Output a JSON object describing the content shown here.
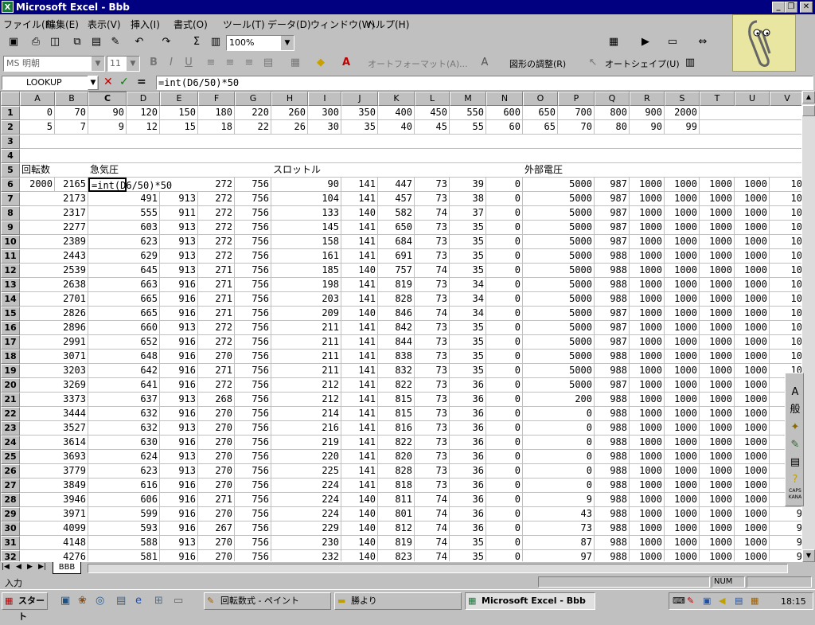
{
  "window": {
    "title": "Microsoft Excel - Bbb",
    "app_icon": "X"
  },
  "menu": [
    "ファイル(F)",
    "編集(E)",
    "表示(V)",
    "挿入(I)",
    "書式(O)",
    "ツール(T)",
    "データ(D)",
    "ウィンドウ(W)",
    "ヘルプ(H)"
  ],
  "toolbar": {
    "zoom": "100%",
    "autosum": "Σ"
  },
  "format_toolbar": {
    "font": "MS 明朝",
    "size": "11",
    "bold": "B",
    "italic": "I",
    "underline": "U",
    "autoformat": "オートフォーマット(A)...",
    "adjust": "図形の調整(R)",
    "autoshape": "オートシェイプ(U)"
  },
  "formula": {
    "namebox": "LOOKUP",
    "text": "=int(D6/50)*50",
    "cancel": "✕",
    "enter": "✓",
    "equals": "="
  },
  "columns": [
    "A",
    "B",
    "C",
    "D",
    "E",
    "F",
    "G",
    "H",
    "I",
    "J",
    "K",
    "L",
    "M",
    "N",
    "O",
    "P",
    "Q",
    "R",
    "S",
    "T",
    "U",
    "V"
  ],
  "rows": [
    [
      "0",
      "70",
      "90",
      "120",
      "150",
      "180",
      "220",
      "260",
      "300",
      "350",
      "400",
      "450",
      "550",
      "600",
      "650",
      "700",
      "800",
      "900",
      "2000",
      "",
      "",
      ""
    ],
    [
      "5",
      "7",
      "9",
      "12",
      "15",
      "18",
      "22",
      "26",
      "30",
      "35",
      "40",
      "45",
      "55",
      "60",
      "65",
      "70",
      "80",
      "90",
      "99",
      "",
      "",
      ""
    ],
    [
      "",
      "",
      "",
      "",
      "",
      "",
      "",
      "",
      "",
      "",
      "",
      "",
      "",
      "",
      "",
      "",
      "",
      "",
      "",
      "",
      "",
      ""
    ],
    [
      "",
      "",
      "",
      "",
      "",
      "",
      "",
      "",
      "",
      "",
      "",
      "",
      "",
      "",
      "",
      "",
      "",
      "",
      "",
      "",
      "",
      ""
    ],
    [
      "回転数",
      "",
      "急気圧",
      "",
      "",
      "",
      "",
      "スロットル",
      "",
      "",
      "",
      "",
      "",
      "",
      "外部電圧",
      "",
      "",
      "",
      "",
      "",
      "",
      ""
    ],
    [
      "2000",
      "2165",
      "=int(D6/50)*50",
      "",
      "",
      "272",
      "756",
      "",
      "90",
      "141",
      "447",
      "73",
      "39",
      "0",
      "",
      "5000",
      "987",
      "1000",
      "1000",
      "1000",
      "1000",
      "10"
    ],
    [
      "",
      "2173",
      "",
      "491",
      "913",
      "272",
      "756",
      "",
      "104",
      "141",
      "457",
      "73",
      "38",
      "0",
      "",
      "5000",
      "987",
      "1000",
      "1000",
      "1000",
      "1000",
      "10"
    ],
    [
      "",
      "2317",
      "",
      "555",
      "911",
      "272",
      "756",
      "",
      "133",
      "140",
      "582",
      "74",
      "37",
      "0",
      "",
      "5000",
      "987",
      "1000",
      "1000",
      "1000",
      "1000",
      "10"
    ],
    [
      "",
      "2277",
      "",
      "603",
      "913",
      "272",
      "756",
      "",
      "145",
      "141",
      "650",
      "73",
      "35",
      "0",
      "",
      "5000",
      "987",
      "1000",
      "1000",
      "1000",
      "1000",
      "10"
    ],
    [
      "",
      "2389",
      "",
      "623",
      "913",
      "272",
      "756",
      "",
      "158",
      "141",
      "684",
      "73",
      "35",
      "0",
      "",
      "5000",
      "987",
      "1000",
      "1000",
      "1000",
      "1000",
      "10"
    ],
    [
      "",
      "2443",
      "",
      "629",
      "913",
      "272",
      "756",
      "",
      "161",
      "141",
      "691",
      "73",
      "35",
      "0",
      "",
      "5000",
      "988",
      "1000",
      "1000",
      "1000",
      "1000",
      "10"
    ],
    [
      "",
      "2539",
      "",
      "645",
      "913",
      "271",
      "756",
      "",
      "185",
      "140",
      "757",
      "74",
      "35",
      "0",
      "",
      "5000",
      "988",
      "1000",
      "1000",
      "1000",
      "1000",
      "10"
    ],
    [
      "",
      "2638",
      "",
      "663",
      "916",
      "271",
      "756",
      "",
      "198",
      "141",
      "819",
      "73",
      "34",
      "0",
      "",
      "5000",
      "988",
      "1000",
      "1000",
      "1000",
      "1000",
      "10"
    ],
    [
      "",
      "2701",
      "",
      "665",
      "916",
      "271",
      "756",
      "",
      "203",
      "141",
      "828",
      "73",
      "34",
      "0",
      "",
      "5000",
      "988",
      "1000",
      "1000",
      "1000",
      "1000",
      "10"
    ],
    [
      "",
      "2826",
      "",
      "665",
      "916",
      "271",
      "756",
      "",
      "209",
      "140",
      "846",
      "74",
      "34",
      "0",
      "",
      "5000",
      "987",
      "1000",
      "1000",
      "1000",
      "1000",
      "10"
    ],
    [
      "",
      "2896",
      "",
      "660",
      "913",
      "272",
      "756",
      "",
      "211",
      "141",
      "842",
      "73",
      "35",
      "0",
      "",
      "5000",
      "987",
      "1000",
      "1000",
      "1000",
      "1000",
      "10"
    ],
    [
      "",
      "2991",
      "",
      "652",
      "916",
      "272",
      "756",
      "",
      "211",
      "141",
      "844",
      "73",
      "35",
      "0",
      "",
      "5000",
      "987",
      "1000",
      "1000",
      "1000",
      "1000",
      "10"
    ],
    [
      "",
      "3071",
      "",
      "648",
      "916",
      "270",
      "756",
      "",
      "211",
      "141",
      "838",
      "73",
      "35",
      "0",
      "",
      "5000",
      "988",
      "1000",
      "1000",
      "1000",
      "1000",
      "10"
    ],
    [
      "",
      "3203",
      "",
      "642",
      "916",
      "271",
      "756",
      "",
      "211",
      "141",
      "832",
      "73",
      "35",
      "0",
      "",
      "5000",
      "988",
      "1000",
      "1000",
      "1000",
      "1000",
      "10"
    ],
    [
      "",
      "3269",
      "",
      "641",
      "916",
      "272",
      "756",
      "",
      "212",
      "141",
      "822",
      "73",
      "36",
      "0",
      "",
      "5000",
      "987",
      "1000",
      "1000",
      "1000",
      "1000",
      "10"
    ],
    [
      "",
      "3373",
      "",
      "637",
      "913",
      "268",
      "756",
      "",
      "212",
      "141",
      "815",
      "73",
      "36",
      "0",
      "",
      "200",
      "988",
      "1000",
      "1000",
      "1000",
      "1000",
      "10"
    ],
    [
      "",
      "3444",
      "",
      "632",
      "916",
      "270",
      "756",
      "",
      "214",
      "141",
      "815",
      "73",
      "36",
      "0",
      "",
      "0",
      "988",
      "1000",
      "1000",
      "1000",
      "1000",
      "10"
    ],
    [
      "",
      "3527",
      "",
      "632",
      "913",
      "270",
      "756",
      "",
      "216",
      "141",
      "816",
      "73",
      "36",
      "0",
      "",
      "0",
      "988",
      "1000",
      "1000",
      "1000",
      "1000",
      "10"
    ],
    [
      "",
      "3614",
      "",
      "630",
      "916",
      "270",
      "756",
      "",
      "219",
      "141",
      "822",
      "73",
      "36",
      "0",
      "",
      "0",
      "988",
      "1000",
      "1000",
      "1000",
      "1000",
      "10"
    ],
    [
      "",
      "3693",
      "",
      "624",
      "913",
      "270",
      "756",
      "",
      "220",
      "141",
      "820",
      "73",
      "36",
      "0",
      "",
      "0",
      "988",
      "1000",
      "1000",
      "1000",
      "1000",
      "10"
    ],
    [
      "",
      "3779",
      "",
      "623",
      "913",
      "270",
      "756",
      "",
      "225",
      "141",
      "828",
      "73",
      "36",
      "0",
      "",
      "0",
      "988",
      "1000",
      "1000",
      "1000",
      "1000",
      "10"
    ],
    [
      "",
      "3849",
      "",
      "616",
      "916",
      "270",
      "756",
      "",
      "224",
      "141",
      "818",
      "73",
      "36",
      "0",
      "",
      "0",
      "988",
      "1000",
      "1000",
      "1000",
      "1000",
      "10"
    ],
    [
      "",
      "3946",
      "",
      "606",
      "916",
      "271",
      "756",
      "",
      "224",
      "140",
      "811",
      "74",
      "36",
      "0",
      "",
      "9",
      "988",
      "1000",
      "1000",
      "1000",
      "1000",
      "10"
    ],
    [
      "",
      "3971",
      "",
      "599",
      "916",
      "270",
      "756",
      "",
      "224",
      "140",
      "801",
      "74",
      "36",
      "0",
      "",
      "43",
      "988",
      "1000",
      "1000",
      "1000",
      "1000",
      "9"
    ],
    [
      "",
      "4099",
      "",
      "593",
      "916",
      "267",
      "756",
      "",
      "229",
      "140",
      "812",
      "74",
      "36",
      "0",
      "",
      "73",
      "988",
      "1000",
      "1000",
      "1000",
      "1000",
      "9"
    ],
    [
      "",
      "4148",
      "",
      "588",
      "913",
      "270",
      "756",
      "",
      "230",
      "140",
      "819",
      "74",
      "35",
      "0",
      "",
      "87",
      "988",
      "1000",
      "1000",
      "1000",
      "1000",
      "9"
    ],
    [
      "",
      "4276",
      "",
      "581",
      "916",
      "270",
      "756",
      "",
      "232",
      "140",
      "823",
      "74",
      "35",
      "0",
      "",
      "97",
      "988",
      "1000",
      "1000",
      "1000",
      "1000",
      "9"
    ]
  ],
  "sheet_tab": "BBB",
  "status": {
    "mode": "入力",
    "num": "NUM"
  },
  "taskbar": {
    "start": "スタート",
    "tasks": [
      "回転数式 - ペイント",
      "勝より",
      "Microsoft Excel - Bbb"
    ],
    "clock": "18:15"
  },
  "palette": [
    "A",
    "般",
    "",
    "",
    "",
    "CAPS KANA"
  ]
}
